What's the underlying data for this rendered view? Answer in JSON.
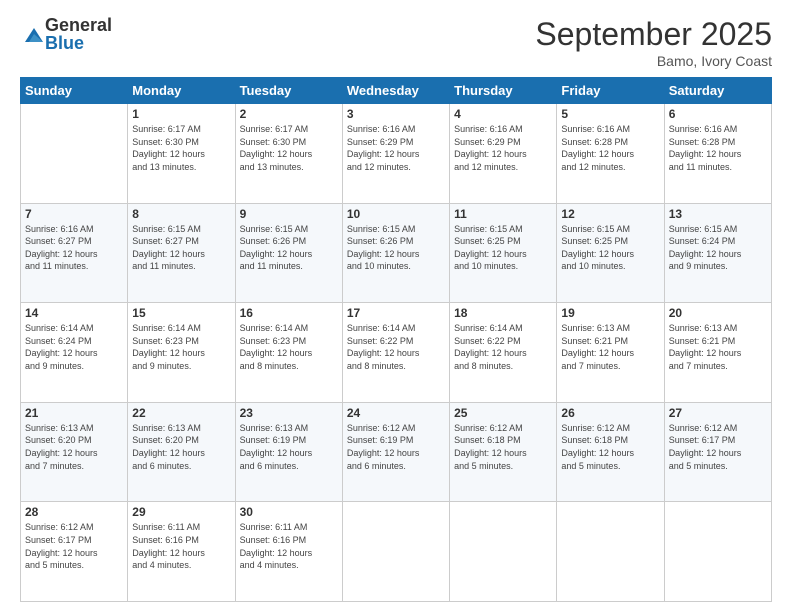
{
  "logo": {
    "general": "General",
    "blue": "Blue"
  },
  "title": "September 2025",
  "location": "Bamo, Ivory Coast",
  "days_of_week": [
    "Sunday",
    "Monday",
    "Tuesday",
    "Wednesday",
    "Thursday",
    "Friday",
    "Saturday"
  ],
  "weeks": [
    [
      {
        "day": "",
        "info": ""
      },
      {
        "day": "1",
        "info": "Sunrise: 6:17 AM\nSunset: 6:30 PM\nDaylight: 12 hours\nand 13 minutes."
      },
      {
        "day": "2",
        "info": "Sunrise: 6:17 AM\nSunset: 6:30 PM\nDaylight: 12 hours\nand 13 minutes."
      },
      {
        "day": "3",
        "info": "Sunrise: 6:16 AM\nSunset: 6:29 PM\nDaylight: 12 hours\nand 12 minutes."
      },
      {
        "day": "4",
        "info": "Sunrise: 6:16 AM\nSunset: 6:29 PM\nDaylight: 12 hours\nand 12 minutes."
      },
      {
        "day": "5",
        "info": "Sunrise: 6:16 AM\nSunset: 6:28 PM\nDaylight: 12 hours\nand 12 minutes."
      },
      {
        "day": "6",
        "info": "Sunrise: 6:16 AM\nSunset: 6:28 PM\nDaylight: 12 hours\nand 11 minutes."
      }
    ],
    [
      {
        "day": "7",
        "info": "Sunrise: 6:16 AM\nSunset: 6:27 PM\nDaylight: 12 hours\nand 11 minutes."
      },
      {
        "day": "8",
        "info": "Sunrise: 6:15 AM\nSunset: 6:27 PM\nDaylight: 12 hours\nand 11 minutes."
      },
      {
        "day": "9",
        "info": "Sunrise: 6:15 AM\nSunset: 6:26 PM\nDaylight: 12 hours\nand 11 minutes."
      },
      {
        "day": "10",
        "info": "Sunrise: 6:15 AM\nSunset: 6:26 PM\nDaylight: 12 hours\nand 10 minutes."
      },
      {
        "day": "11",
        "info": "Sunrise: 6:15 AM\nSunset: 6:25 PM\nDaylight: 12 hours\nand 10 minutes."
      },
      {
        "day": "12",
        "info": "Sunrise: 6:15 AM\nSunset: 6:25 PM\nDaylight: 12 hours\nand 10 minutes."
      },
      {
        "day": "13",
        "info": "Sunrise: 6:15 AM\nSunset: 6:24 PM\nDaylight: 12 hours\nand 9 minutes."
      }
    ],
    [
      {
        "day": "14",
        "info": "Sunrise: 6:14 AM\nSunset: 6:24 PM\nDaylight: 12 hours\nand 9 minutes."
      },
      {
        "day": "15",
        "info": "Sunrise: 6:14 AM\nSunset: 6:23 PM\nDaylight: 12 hours\nand 9 minutes."
      },
      {
        "day": "16",
        "info": "Sunrise: 6:14 AM\nSunset: 6:23 PM\nDaylight: 12 hours\nand 8 minutes."
      },
      {
        "day": "17",
        "info": "Sunrise: 6:14 AM\nSunset: 6:22 PM\nDaylight: 12 hours\nand 8 minutes."
      },
      {
        "day": "18",
        "info": "Sunrise: 6:14 AM\nSunset: 6:22 PM\nDaylight: 12 hours\nand 8 minutes."
      },
      {
        "day": "19",
        "info": "Sunrise: 6:13 AM\nSunset: 6:21 PM\nDaylight: 12 hours\nand 7 minutes."
      },
      {
        "day": "20",
        "info": "Sunrise: 6:13 AM\nSunset: 6:21 PM\nDaylight: 12 hours\nand 7 minutes."
      }
    ],
    [
      {
        "day": "21",
        "info": "Sunrise: 6:13 AM\nSunset: 6:20 PM\nDaylight: 12 hours\nand 7 minutes."
      },
      {
        "day": "22",
        "info": "Sunrise: 6:13 AM\nSunset: 6:20 PM\nDaylight: 12 hours\nand 6 minutes."
      },
      {
        "day": "23",
        "info": "Sunrise: 6:13 AM\nSunset: 6:19 PM\nDaylight: 12 hours\nand 6 minutes."
      },
      {
        "day": "24",
        "info": "Sunrise: 6:12 AM\nSunset: 6:19 PM\nDaylight: 12 hours\nand 6 minutes."
      },
      {
        "day": "25",
        "info": "Sunrise: 6:12 AM\nSunset: 6:18 PM\nDaylight: 12 hours\nand 5 minutes."
      },
      {
        "day": "26",
        "info": "Sunrise: 6:12 AM\nSunset: 6:18 PM\nDaylight: 12 hours\nand 5 minutes."
      },
      {
        "day": "27",
        "info": "Sunrise: 6:12 AM\nSunset: 6:17 PM\nDaylight: 12 hours\nand 5 minutes."
      }
    ],
    [
      {
        "day": "28",
        "info": "Sunrise: 6:12 AM\nSunset: 6:17 PM\nDaylight: 12 hours\nand 5 minutes."
      },
      {
        "day": "29",
        "info": "Sunrise: 6:11 AM\nSunset: 6:16 PM\nDaylight: 12 hours\nand 4 minutes."
      },
      {
        "day": "30",
        "info": "Sunrise: 6:11 AM\nSunset: 6:16 PM\nDaylight: 12 hours\nand 4 minutes."
      },
      {
        "day": "",
        "info": ""
      },
      {
        "day": "",
        "info": ""
      },
      {
        "day": "",
        "info": ""
      },
      {
        "day": "",
        "info": ""
      }
    ]
  ]
}
